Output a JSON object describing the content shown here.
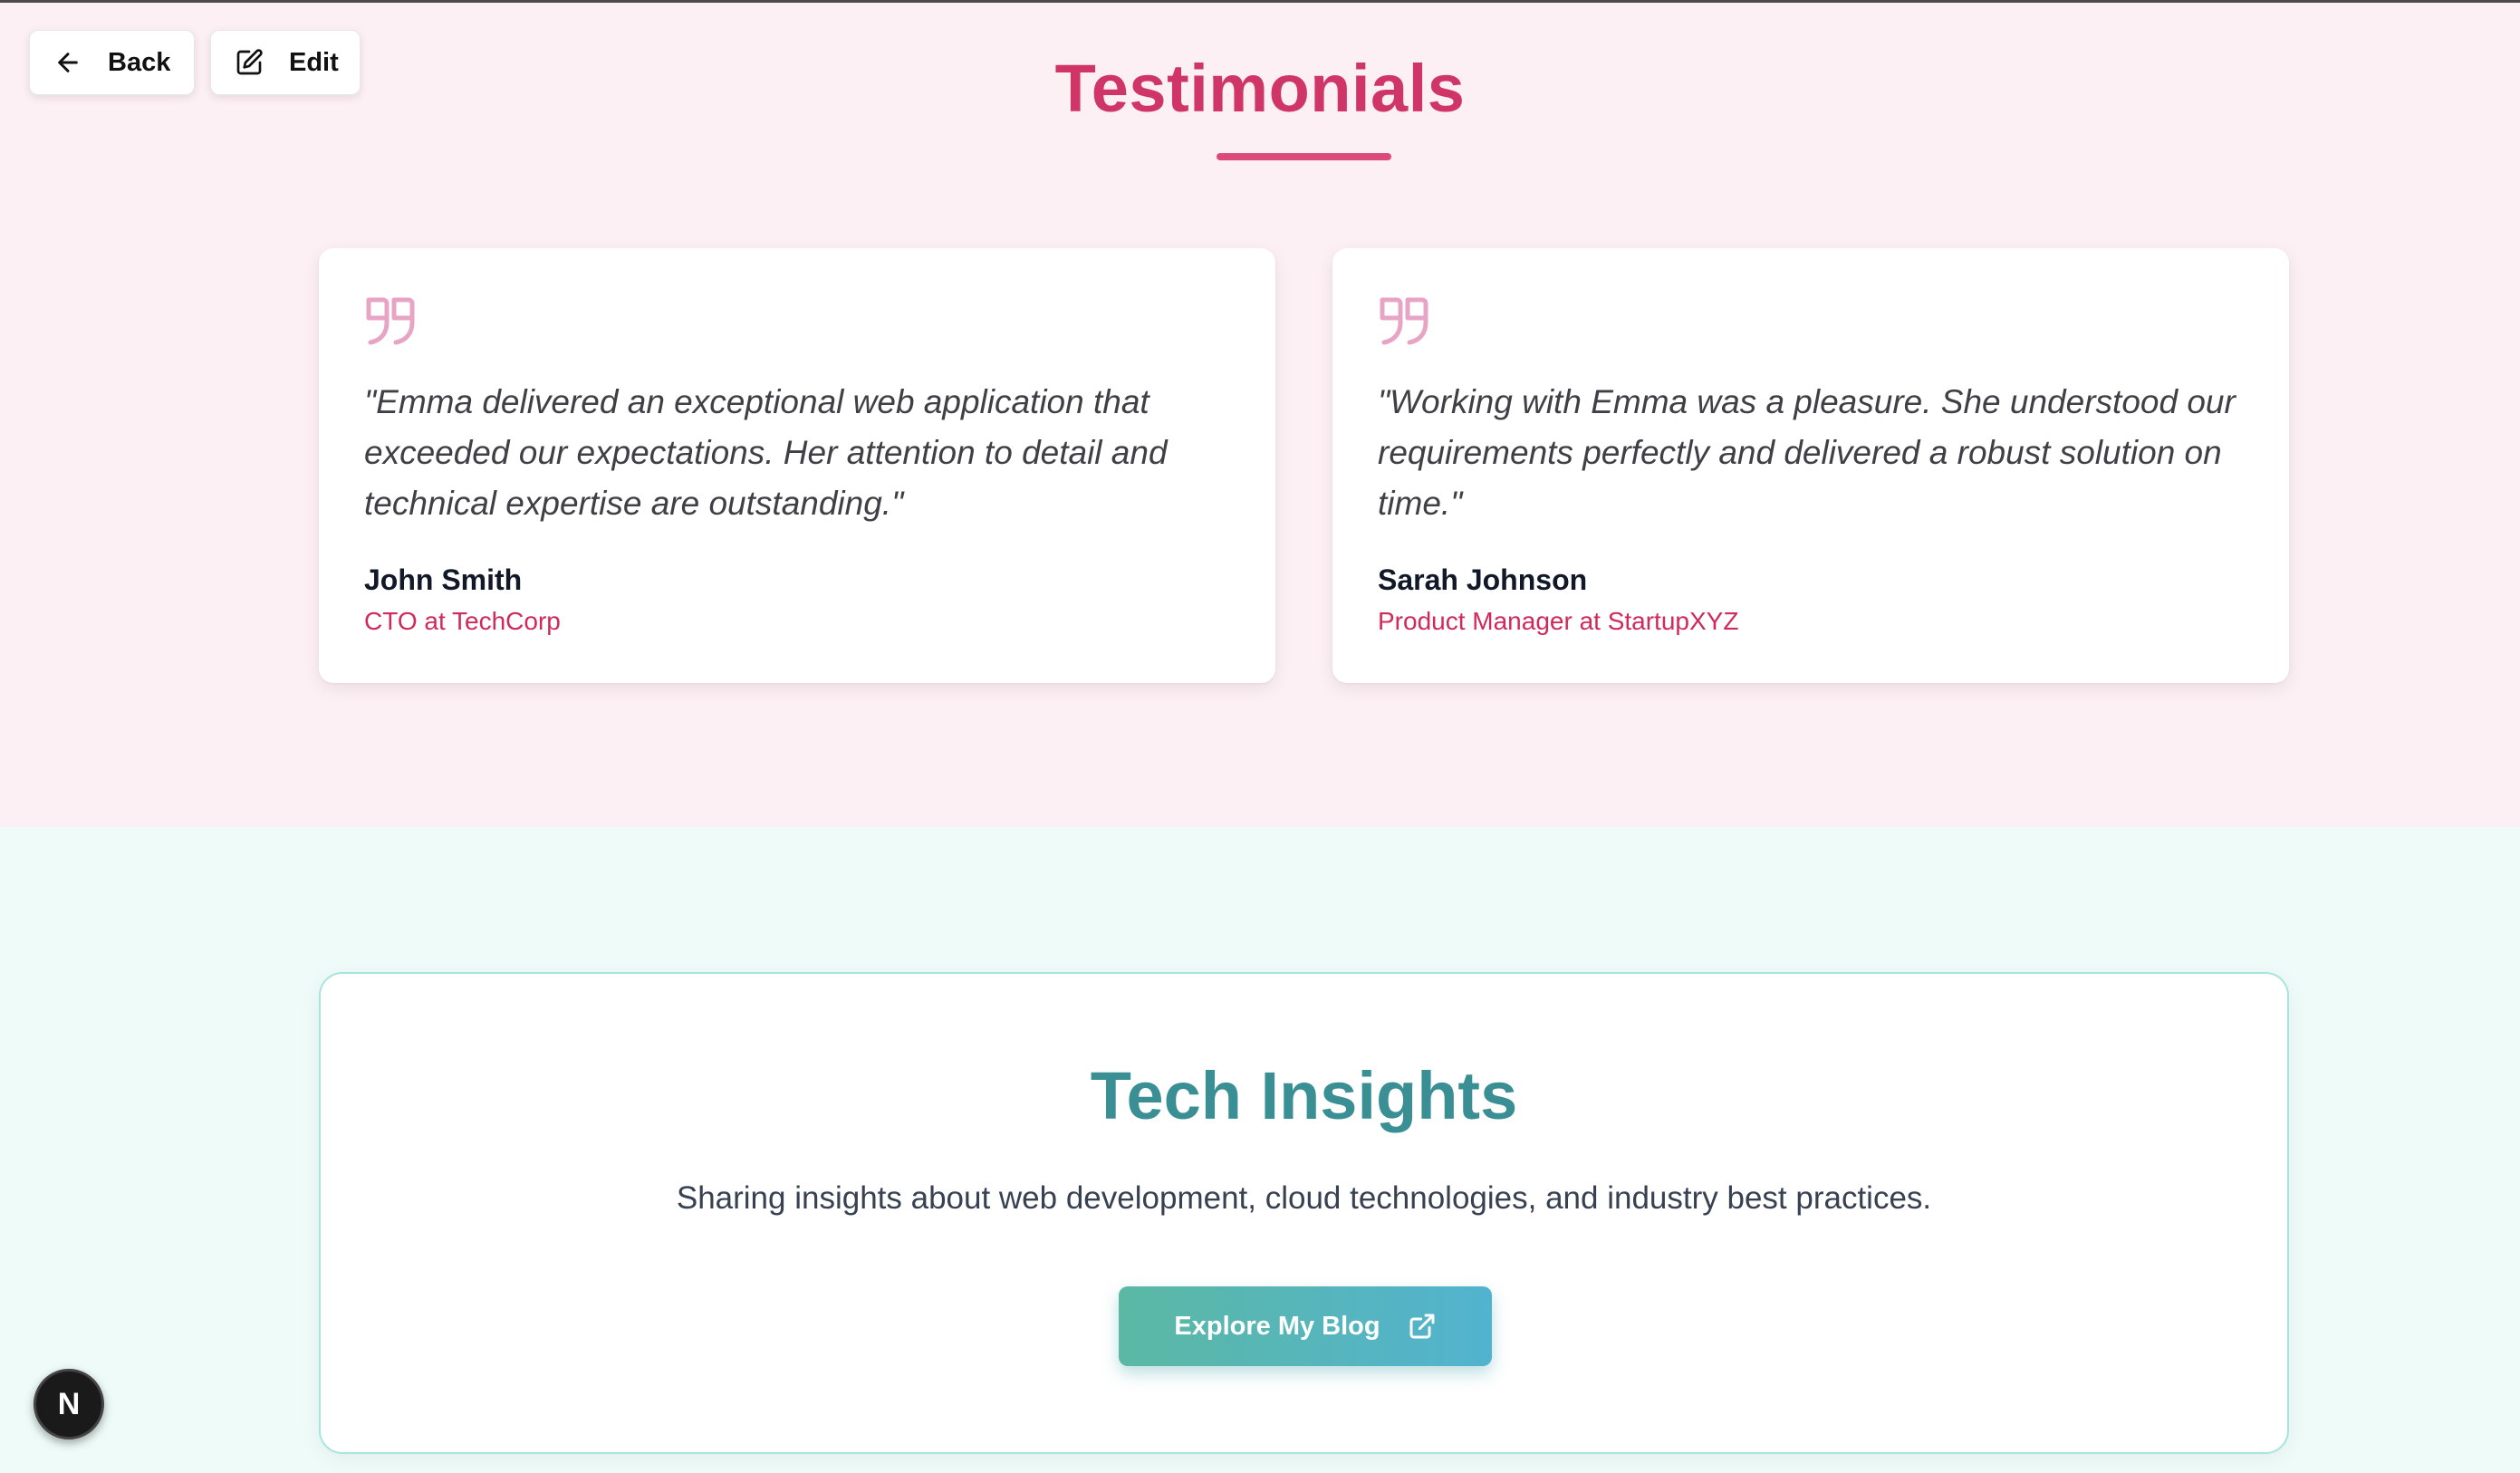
{
  "nav": {
    "back_label": "Back",
    "edit_label": "Edit"
  },
  "testimonials": {
    "title": "Testimonials",
    "items": [
      {
        "quote": "\"Emma delivered an exceptional web application that exceeded our expectations. Her attention to detail and technical expertise are outstanding.\"",
        "name": "John Smith",
        "role": "CTO at TechCorp"
      },
      {
        "quote": "\"Working with Emma was a pleasure. She understood our requirements perfectly and delivered a robust solution on time.\"",
        "name": "Sarah Johnson",
        "role": "Product Manager at StartupXYZ"
      }
    ]
  },
  "insights": {
    "title": "Tech Insights",
    "description": "Sharing insights about web development, cloud technologies, and industry best practices.",
    "button_label": "Explore My Blog"
  },
  "badge": {
    "letter": "N"
  },
  "colors": {
    "accent_pink": "#cf3566",
    "accent_teal": "#3a8f94",
    "quote_icon": "#e7a4c4"
  },
  "icons": [
    "arrow-left-icon",
    "edit-icon",
    "quote-icon",
    "external-link-icon",
    "next-logo-icon"
  ]
}
